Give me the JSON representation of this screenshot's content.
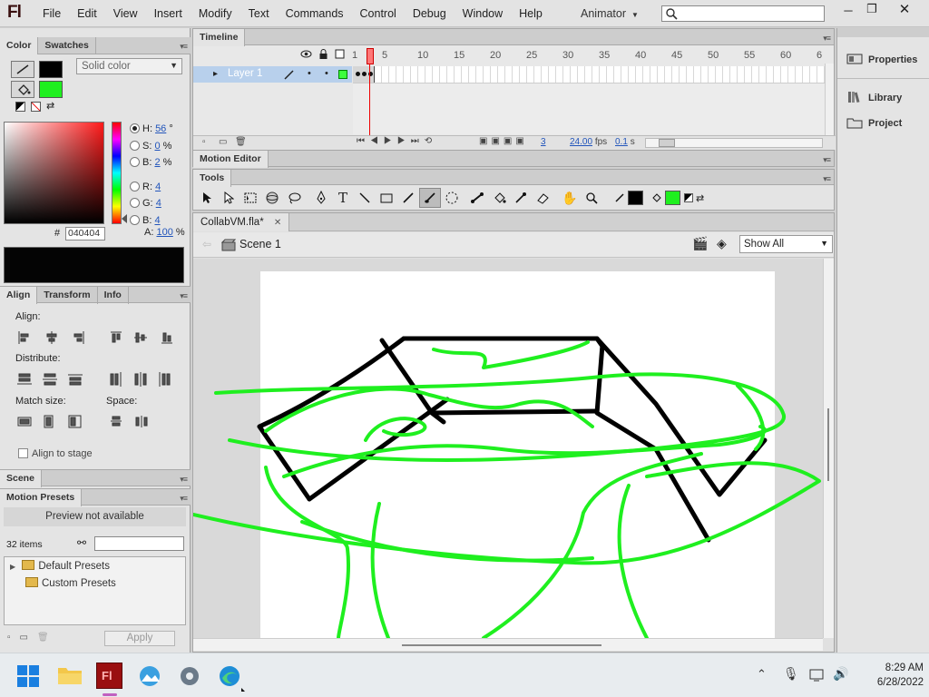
{
  "app": {
    "logo": "Fl",
    "workspace": "Animator"
  },
  "menus": [
    "File",
    "Edit",
    "View",
    "Insert",
    "Modify",
    "Text",
    "Commands",
    "Control",
    "Debug",
    "Window",
    "Help"
  ],
  "color_panel": {
    "tabs": [
      "Color",
      "Swatches"
    ],
    "fill_type": "Solid color",
    "hsb": {
      "h_label": "H:",
      "h": "56",
      "h_unit": "°",
      "s_label": "S:",
      "s": "0",
      "s_unit": "%",
      "b_label": "B:",
      "b": "2",
      "b_unit": "%"
    },
    "rgb": {
      "r_label": "R:",
      "r": "4",
      "g_label": "G:",
      "g": "4",
      "b_label": "B:",
      "b": "4"
    },
    "hex_label": "#",
    "hex": "040404",
    "alpha_label": "A:",
    "alpha": "100",
    "alpha_unit": "%",
    "stroke_color": "#000000",
    "fill_color": "#1fef1f"
  },
  "align_panel": {
    "tabs": [
      "Align",
      "Transform",
      "Info"
    ],
    "align_label": "Align:",
    "distribute_label": "Distribute:",
    "match_label": "Match size:",
    "space_label": "Space:",
    "stage_label": "Align to stage"
  },
  "scene_panel": {
    "title": "Scene"
  },
  "motion_presets": {
    "title": "Motion Presets",
    "preview": "Preview not available",
    "count": "32 items",
    "folders": [
      "Default Presets",
      "Custom Presets"
    ],
    "apply": "Apply"
  },
  "timeline": {
    "title": "Timeline",
    "layer": "Layer 1",
    "ruler": [
      "1",
      "5",
      "10",
      "15",
      "20",
      "25",
      "30",
      "35",
      "40",
      "45",
      "50",
      "55",
      "60",
      "6"
    ],
    "current_frame": "3",
    "fps": "24.00",
    "fps_unit": "fps",
    "time": "0.1",
    "time_unit": "s"
  },
  "motion_editor": {
    "title": "Motion Editor"
  },
  "tools_panel": {
    "title": "Tools",
    "stroke_color": "#000000",
    "fill_color": "#1fef1f"
  },
  "document": {
    "tab": "CollabVM.fla*",
    "scene": "Scene 1",
    "zoom": "Show All"
  },
  "right_panel": {
    "items": [
      "Properties",
      "Library",
      "Project"
    ]
  },
  "taskbar": {
    "time": "8:29 AM",
    "date": "6/28/2022"
  },
  "icons": [
    "search-icon",
    "minimize-icon",
    "restore-icon",
    "close-icon",
    "eye-icon",
    "lock-icon",
    "outline-icon",
    "pencil-icon",
    "arrow-tool-icon",
    "subselect-icon",
    "free-transform-icon",
    "3d-rotation-icon",
    "lasso-icon",
    "pen-icon",
    "text-icon",
    "line-icon",
    "rectangle-icon",
    "pencil-tool-icon",
    "brush-icon",
    "deco-icon",
    "bone-icon",
    "paint-bucket-icon",
    "eyedropper-icon",
    "eraser-icon",
    "hand-icon",
    "zoom-icon",
    "windows-start-icon",
    "file-explorer-icon",
    "flash-icon",
    "photos-icon",
    "settings-icon",
    "edge-icon",
    "wifi-icon",
    "volume-icon"
  ]
}
